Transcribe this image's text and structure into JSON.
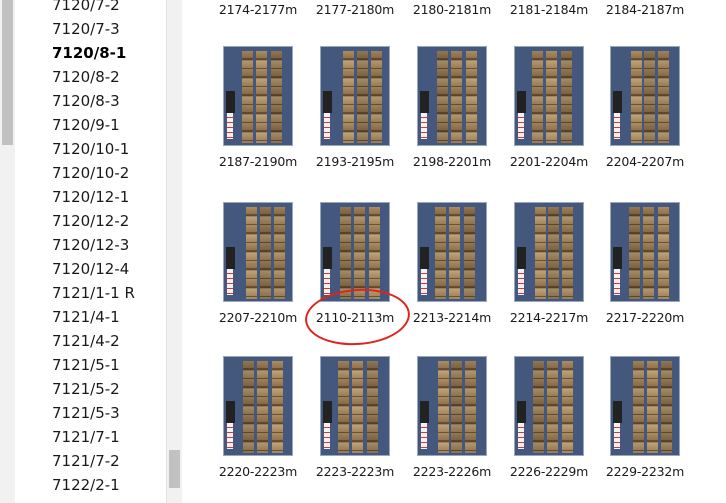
{
  "well_list": {
    "items": [
      {
        "label": "7120/7-2"
      },
      {
        "label": "7120/7-3"
      },
      {
        "label": "7120/8-1",
        "selected": true
      },
      {
        "label": "7120/8-2"
      },
      {
        "label": "7120/8-3"
      },
      {
        "label": "7120/9-1"
      },
      {
        "label": "7120/10-1"
      },
      {
        "label": "7120/10-2"
      },
      {
        "label": "7120/12-1"
      },
      {
        "label": "7120/12-2"
      },
      {
        "label": "7120/12-3"
      },
      {
        "label": "7120/12-4"
      },
      {
        "label": "7121/1-1 R"
      },
      {
        "label": "7121/4-1"
      },
      {
        "label": "7121/4-2"
      },
      {
        "label": "7121/5-1"
      },
      {
        "label": "7121/5-2"
      },
      {
        "label": "7121/5-3"
      },
      {
        "label": "7121/7-1"
      },
      {
        "label": "7121/7-2"
      },
      {
        "label": "7122/2-1"
      }
    ]
  },
  "gallery": {
    "rows": [
      [
        "2174-2177m",
        "2177-2180m",
        "2180-2181m",
        "2181-2184m",
        "2184-2187m"
      ],
      [
        "2187-2190m",
        "2193-2195m",
        "2198-2201m",
        "2201-2204m",
        "2204-2207m"
      ],
      [
        "2207-2210m",
        "2110-2113m",
        "2213-2214m",
        "2214-2217m",
        "2217-2220m"
      ],
      [
        "2220-2223m",
        "2223-2223m",
        "2223-2226m",
        "2226-2229m",
        "2229-2232m"
      ]
    ]
  },
  "annotation": {
    "color": "#e0241b",
    "target_caption": "2110-2113m"
  },
  "colors": {
    "tray_background": "#44577c",
    "selected_text": "#000000"
  }
}
